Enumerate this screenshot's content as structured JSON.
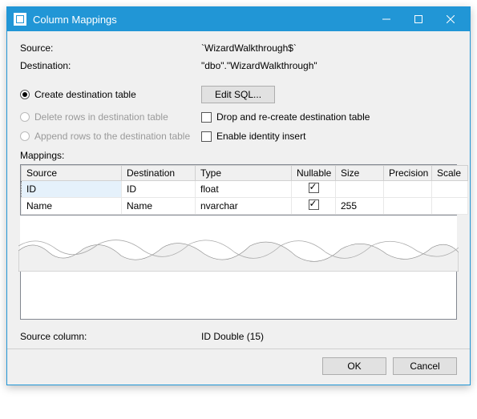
{
  "window": {
    "title": "Column Mappings"
  },
  "fields": {
    "source_label": "Source:",
    "source_value": "`WizardWalkthrough$`",
    "destination_label": "Destination:",
    "destination_value": "\"dbo\".\"WizardWalkthrough\""
  },
  "options": {
    "create_table": "Create destination table",
    "edit_sql": "Edit SQL...",
    "delete_rows": "Delete rows in destination table",
    "drop_recreate": "Drop and re-create destination table",
    "append_rows": "Append rows to the destination table",
    "identity_insert": "Enable identity insert"
  },
  "mappings": {
    "label": "Mappings:",
    "headers": {
      "source": "Source",
      "destination": "Destination",
      "type": "Type",
      "nullable": "Nullable",
      "size": "Size",
      "precision": "Precision",
      "scale": "Scale"
    },
    "rows": [
      {
        "source": "ID",
        "destination": "ID",
        "type": "float",
        "nullable": true,
        "size": "",
        "precision": "",
        "scale": ""
      },
      {
        "source": "Name",
        "destination": "Name",
        "type": "nvarchar",
        "nullable": true,
        "size": "255",
        "precision": "",
        "scale": ""
      }
    ]
  },
  "source_column": {
    "label": "Source column:",
    "value": "ID Double (15)"
  },
  "buttons": {
    "ok": "OK",
    "cancel": "Cancel"
  }
}
